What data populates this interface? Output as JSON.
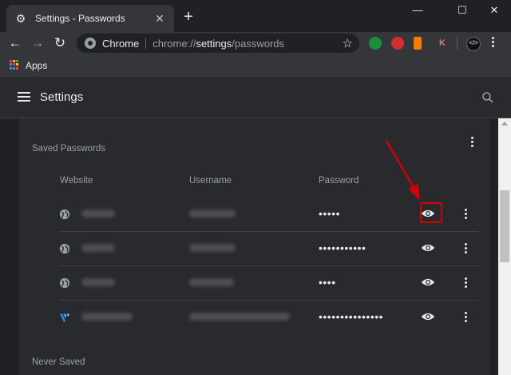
{
  "window": {
    "tab_title": "Settings - Passwords",
    "new_tab_symbol": "+",
    "minimize_symbol": "—",
    "maximize_symbol": "☐",
    "close_symbol": "✕"
  },
  "toolbar": {
    "omnibox_chrome_label": "Chrome",
    "url_prefix": "chrome://",
    "url_host": "settings",
    "url_path": "/passwords",
    "ext_k_label": "K"
  },
  "bookmarks": {
    "apps_label": "Apps"
  },
  "settings": {
    "title": "Settings",
    "saved_passwords_title": "Saved Passwords",
    "never_saved_title": "Never Saved",
    "columns": {
      "website": "Website",
      "username": "Username",
      "password": "Password"
    },
    "rows": [
      {
        "site_icon": "globe-icon",
        "password_mask": "•••••"
      },
      {
        "site_icon": "globe-icon",
        "password_mask": "•••••••••••"
      },
      {
        "site_icon": "globe-icon",
        "password_mask": "••••"
      },
      {
        "site_icon": "vultr-logo-icon",
        "password_mask": "•••••••••••••••"
      }
    ]
  },
  "colors": {
    "annotation_red": "#d50000",
    "background": "#202124",
    "card": "#292a2d"
  }
}
